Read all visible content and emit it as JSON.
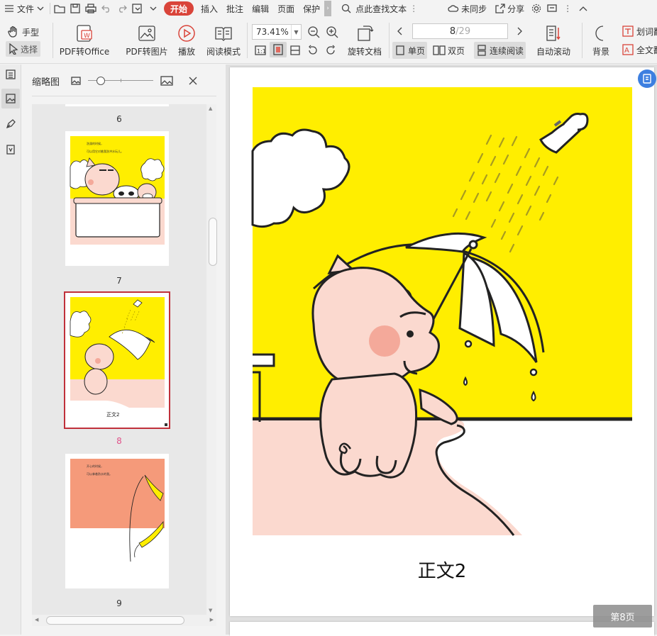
{
  "menubar": {
    "file": "文件",
    "tabs": [
      "开始",
      "插入",
      "批注",
      "编辑",
      "页面",
      "保护"
    ],
    "search_placeholder": "点此查找文本",
    "sync": "未同步",
    "share": "分享"
  },
  "toolbar": {
    "hand": "手型",
    "select": "选择",
    "pdf_to_office": "PDF转Office",
    "pdf_to_image": "PDF转图片",
    "play": "播放",
    "read_mode": "阅读模式",
    "zoom": "73.41%",
    "rotate_doc": "旋转文档",
    "page_current": "8",
    "page_total": "/29",
    "single_page": "单页",
    "double_page": "双页",
    "continuous": "连续阅读",
    "auto_scroll": "自动滚动",
    "background": "背景",
    "word_lookup": "划词翻",
    "full_translate": "全文翻"
  },
  "thumbnails": {
    "title": "缩略图",
    "zoom_level": 0.15,
    "pages": [
      {
        "num": "6",
        "selected": false
      },
      {
        "num": "7",
        "selected": false
      },
      {
        "num": "8",
        "selected": true,
        "caption": "正文2"
      },
      {
        "num": "9",
        "selected": false
      }
    ],
    "page7_line1": "洗澡的时候，",
    "page7_line2": "可以用它对着我洗冲水玩儿。",
    "page9_line1": "开心的时候，",
    "page9_line2": "可以拿着防水的我。"
  },
  "document": {
    "caption": "正文2",
    "page_indicator": "第8页"
  },
  "colors": {
    "accent_red": "#d9443a",
    "yellow": "#ffee00",
    "pig_pink": "#fbd9cf",
    "cheek": "#f4a99a",
    "salmon": "#f59a7a",
    "selected_num": "#e0528a"
  }
}
